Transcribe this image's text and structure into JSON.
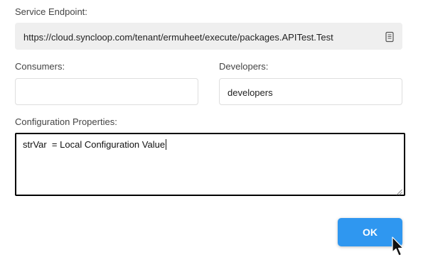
{
  "service_endpoint": {
    "label": "Service Endpoint:",
    "value": "https://cloud.syncloop.com/tenant/ermuheet/execute/packages.APITest.Test",
    "copy_icon": "copy-icon"
  },
  "consumers": {
    "label": "Consumers:",
    "value": ""
  },
  "developers": {
    "label": "Developers:",
    "value": "developers"
  },
  "configuration_properties": {
    "label": "Configuration Properties:",
    "value": "strVar  = Local Configuration Value"
  },
  "ok_button": {
    "label": "OK"
  },
  "colors": {
    "accent": "#2f97f0",
    "readonly_bg": "#efefef",
    "focus_border": "#000000"
  }
}
